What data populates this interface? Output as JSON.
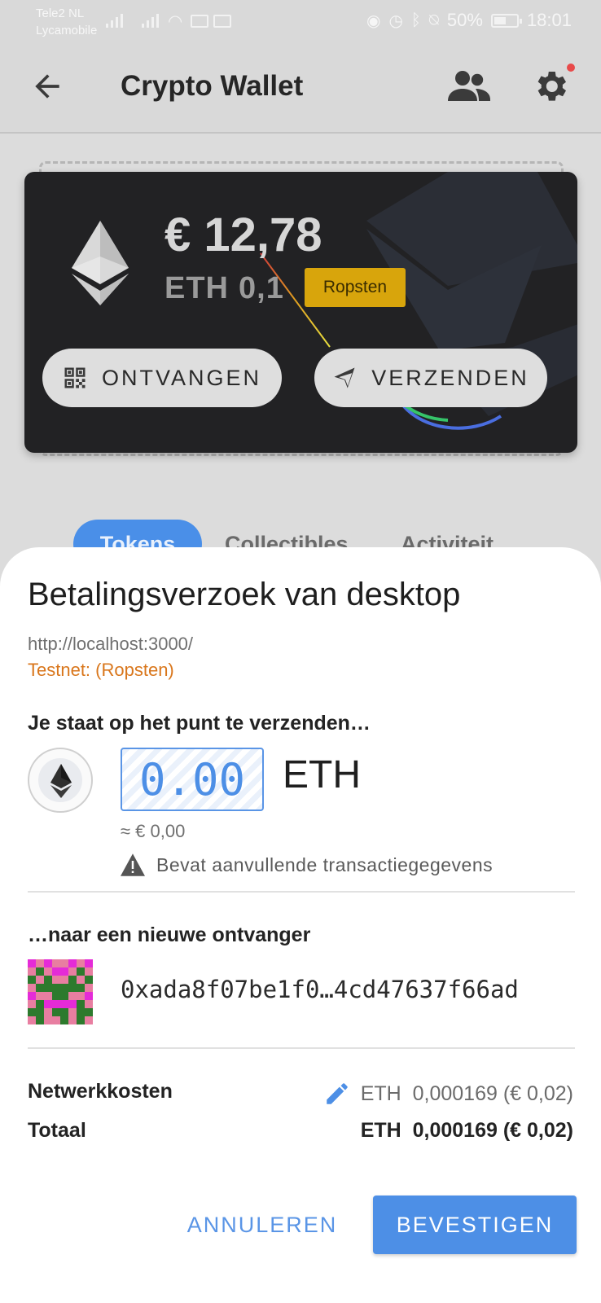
{
  "status_bar": {
    "carrier_1": "Tele2 NL",
    "carrier_2": "Lycamobile",
    "battery_percent": "50%",
    "time": "18:01"
  },
  "app_bar": {
    "title": "Crypto Wallet",
    "icons": [
      "back-arrow-icon",
      "people-icon",
      "gear-icon"
    ],
    "notification_dot_color": "#e84a4a"
  },
  "wallet_card": {
    "fiat_balance": "€ 12,78",
    "eth_symbol": "ETH",
    "eth_balance": "0,1",
    "network_badge": "Ropsten",
    "receive_label": "ONTVANGEN",
    "send_label": "VERZENDEN"
  },
  "tabs": {
    "items": [
      "Tokens",
      "Collectibles",
      "Activiteit"
    ]
  },
  "payment_request": {
    "title": "Betalingsverzoek van desktop",
    "origin": "http://localhost:3000/",
    "network": "Testnet: (Ropsten)",
    "send_heading": "Je staat op het punt te verzenden…",
    "amount_value": "0.00",
    "amount_unit": "ETH",
    "fiat_approx": "≈ € 0,00",
    "warning": "Bevat aanvullende transactiegegevens",
    "recipient_heading": "…naar een nieuwe ontvanger",
    "recipient_address": "0xada8f07be1f0…4cd47637f66ad",
    "fee_label": "Netwerkkosten",
    "fee_value": "ETH  0,000169 (€ 0,02)",
    "total_label": "Totaal",
    "total_value": "ETH  0,000169 (€ 0,02)",
    "cancel_label": "ANNULEREN",
    "confirm_label": "BEVESTIGEN"
  },
  "colors": {
    "accent_blue": "#4d8fe6",
    "testnet_orange": "#d9761b",
    "badge_gold": "#d8a50c",
    "card_dark": "#222224"
  }
}
